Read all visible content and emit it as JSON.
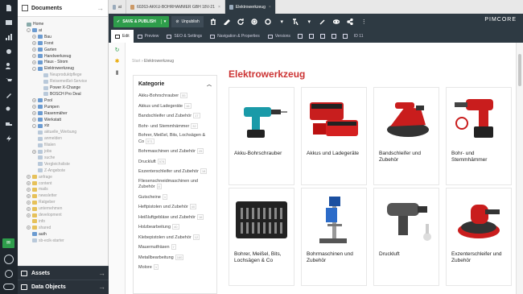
{
  "tree": {
    "title": "Documents",
    "rows": [
      {
        "label": "Home",
        "level": 0,
        "toggle": "",
        "folder": "home",
        "dim": false
      },
      {
        "label": "at",
        "level": 1,
        "toggle": "-",
        "folder": "blue",
        "dim": false
      },
      {
        "label": "Bau",
        "level": 2,
        "toggle": "+",
        "folder": "blue",
        "dim": false
      },
      {
        "label": "Forst",
        "level": 2,
        "toggle": "+",
        "folder": "blue",
        "dim": false
      },
      {
        "label": "Garten",
        "level": 2,
        "toggle": "+",
        "folder": "blue",
        "dim": false
      },
      {
        "label": "Handwerkzeug",
        "level": 2,
        "toggle": "+",
        "folder": "blue",
        "dim": false
      },
      {
        "label": "Haus - Strom",
        "level": 2,
        "toggle": "+",
        "folder": "blue",
        "dim": false
      },
      {
        "label": "Elektrowerkzeug",
        "level": 2,
        "toggle": "-",
        "folder": "blue",
        "dim": false
      },
      {
        "label": "Neuproduktpflege",
        "level": 3,
        "toggle": "",
        "folder": "page",
        "dim": true
      },
      {
        "label": "Reisemeißel-Service",
        "level": 3,
        "toggle": "",
        "folder": "page",
        "dim": true
      },
      {
        "label": "Power X-Change",
        "level": 3,
        "toggle": "",
        "folder": "page",
        "dim": false
      },
      {
        "label": "BOSCH Pro Deal",
        "level": 3,
        "toggle": "",
        "folder": "page",
        "dim": false
      },
      {
        "label": "Pool",
        "level": 2,
        "toggle": "+",
        "folder": "blue",
        "dim": false
      },
      {
        "label": "Pumpen",
        "level": 2,
        "toggle": "+",
        "folder": "blue",
        "dim": false
      },
      {
        "label": "Rasenmäher",
        "level": 2,
        "toggle": "+",
        "folder": "blue",
        "dim": false
      },
      {
        "label": "Werkstatt",
        "level": 2,
        "toggle": "+",
        "folder": "blue",
        "dim": false
      },
      {
        "label": "xtz",
        "level": 2,
        "toggle": "-",
        "folder": "blue",
        "dim": false
      },
      {
        "label": "aktuelle_Werbung",
        "level": 2,
        "toggle": "",
        "folder": "page",
        "dim": true
      },
      {
        "label": "anmelden",
        "level": 2,
        "toggle": "",
        "folder": "page",
        "dim": true
      },
      {
        "label": "filialen",
        "level": 2,
        "toggle": "",
        "folder": "page",
        "dim": true
      },
      {
        "label": "jobs",
        "level": 2,
        "toggle": "+",
        "folder": "page",
        "dim": true
      },
      {
        "label": "suche",
        "level": 2,
        "toggle": "",
        "folder": "page",
        "dim": true
      },
      {
        "label": "Vergleichsliste",
        "level": 2,
        "toggle": "",
        "folder": "page",
        "dim": true
      },
      {
        "label": "Z-Angebote",
        "level": 2,
        "toggle": "",
        "folder": "page",
        "dim": true
      },
      {
        "label": "anfrage",
        "level": 1,
        "toggle": "+",
        "folder": "yellow",
        "dim": true
      },
      {
        "label": "content",
        "level": 1,
        "toggle": "+",
        "folder": "yellow",
        "dim": true
      },
      {
        "label": "mails",
        "level": 1,
        "toggle": "+",
        "folder": "yellow",
        "dim": true
      },
      {
        "label": "newsletter",
        "level": 1,
        "toggle": "+",
        "folder": "yellow",
        "dim": true
      },
      {
        "label": "Ratgeber",
        "level": 1,
        "toggle": "+",
        "folder": "yellow",
        "dim": true
      },
      {
        "label": "unternehmen",
        "level": 1,
        "toggle": "+",
        "folder": "yellow",
        "dim": true
      },
      {
        "label": "development",
        "level": 1,
        "toggle": "+",
        "folder": "yellow",
        "dim": true
      },
      {
        "label": "info",
        "level": 1,
        "toggle": "",
        "folder": "yellow",
        "dim": true
      },
      {
        "label": "shared",
        "level": 1,
        "toggle": "+",
        "folder": "yellow",
        "dim": true
      },
      {
        "label": "auth",
        "level": 1,
        "toggle": "",
        "folder": "blue",
        "dim": false
      },
      {
        "label": "sb-ecik-starter",
        "level": 1,
        "toggle": "",
        "folder": "page",
        "dim": true
      }
    ]
  },
  "lower_panel": {
    "assets": "Assets",
    "data_objects": "Data Objects"
  },
  "tabs": [
    {
      "label": "at",
      "active": false
    },
    {
      "label": "60263-AKKU-BOHRHAMMER GBH 18V-21",
      "active": false
    },
    {
      "label": "Elektrowerkzeug",
      "active": true
    }
  ],
  "toolbar": {
    "save_publish": "SAVE & PUBLISH",
    "unpublish": "Unpublish",
    "brand": "PIMCORE"
  },
  "subtoolbar": {
    "tabs": [
      "Edit",
      "Preview",
      "SEO & Settings",
      "Navigation & Properties",
      "Versions"
    ],
    "id_label": "ID 11"
  },
  "breadcrumb": {
    "home": "Start",
    "current": "Elektrowerkzeug"
  },
  "filter": {
    "title": "Kategorie",
    "items": [
      {
        "label": "Akku-Bohrschrauber",
        "count": "55"
      },
      {
        "label": "Akkus und Ladegeräte",
        "count": "16"
      },
      {
        "label": "Bandschleifer und Zubehör",
        "count": "17"
      },
      {
        "label": "Bohr- und Stemmhämmer",
        "count": "32"
      },
      {
        "label": "Bohrer, Meißel, Bits, Lochsägen & Co",
        "count": "571"
      },
      {
        "label": "Bohrmaschinen und Zubehör",
        "count": "25"
      },
      {
        "label": "Druckluft",
        "count": "578"
      },
      {
        "label": "Exzenterschleifer und Zubehör",
        "count": "18"
      },
      {
        "label": "Fliesenschneidmaschinen und Zubehör",
        "count": "8"
      },
      {
        "label": "Gutscheine",
        "count": "1"
      },
      {
        "label": "Heftpistolen und Zubehör",
        "count": "40"
      },
      {
        "label": "Heißluftgebläse und Zubehör",
        "count": "16"
      },
      {
        "label": "Holzbearbeitung",
        "count": "40"
      },
      {
        "label": "Klebepistolen und Zubehör",
        "count": "12"
      },
      {
        "label": "Mauernutfräsen",
        "count": "7"
      },
      {
        "label": "Metallbearbeitung",
        "count": "160"
      },
      {
        "label": "Molore",
        "count": "1"
      }
    ]
  },
  "heading": "Elektrowerkzeug",
  "products": [
    {
      "label": "Akku-Bohrschrauber",
      "image": "cordless-drill"
    },
    {
      "label": "Akkus und Ladegeräte",
      "image": "battery-charger"
    },
    {
      "label": "Bandschleifer und Zubehör",
      "image": "belt-sander"
    },
    {
      "label": "Bohr- und Stemmhämmer",
      "image": "rotary-hammer"
    },
    {
      "label": "Bohrer, Meißel, Bits, Lochsägen & Co",
      "image": "bit-set"
    },
    {
      "label": "Bohrmaschinen und Zubehör",
      "image": "drill-press"
    },
    {
      "label": "Druckluft",
      "image": "impact-wrench"
    },
    {
      "label": "Exzenterschleifer und Zubehör",
      "image": "orbital-sander"
    }
  ],
  "colors": {
    "accent": "#2e9d4b",
    "heading": "#cc3333",
    "toolbar": "#2e3a43",
    "rail": "#1f262d"
  }
}
